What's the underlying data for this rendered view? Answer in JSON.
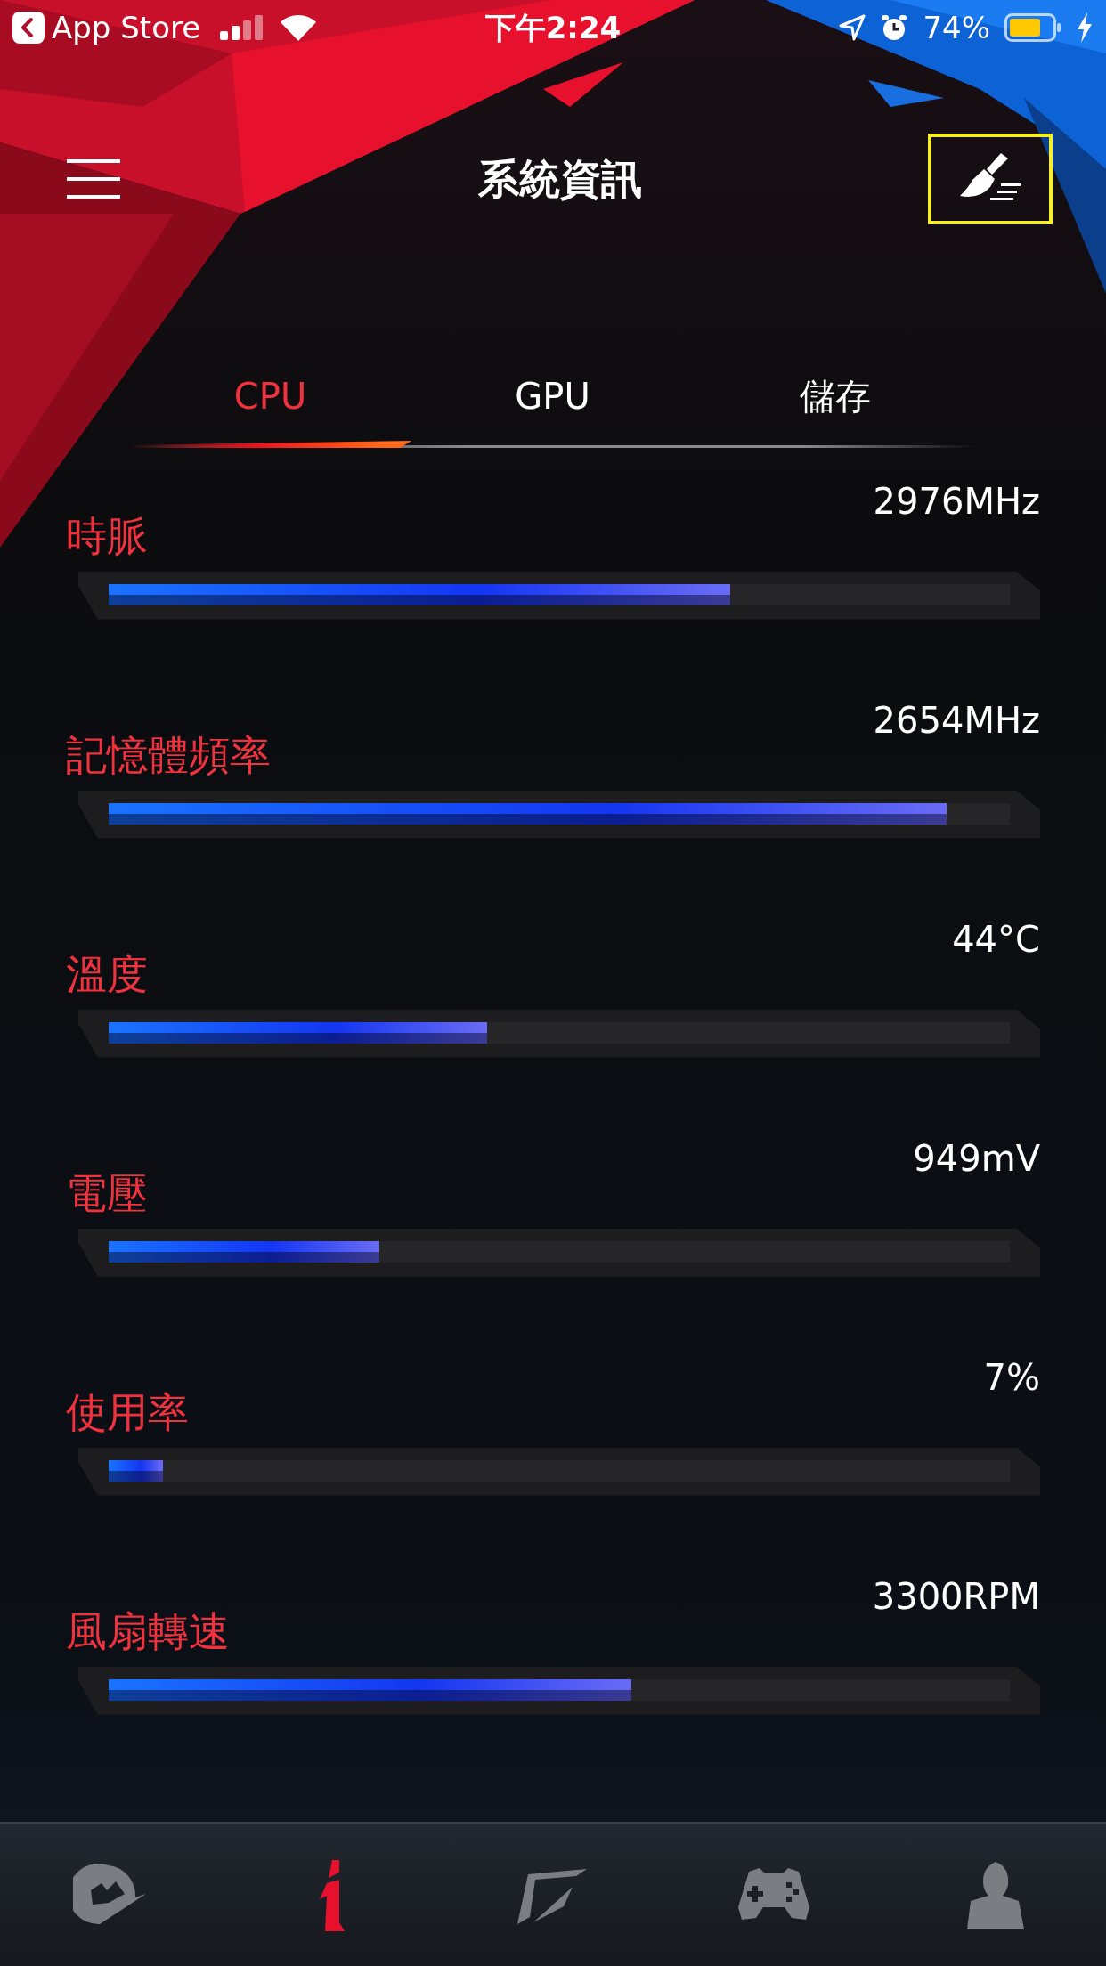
{
  "status_bar": {
    "back_label": "App Store",
    "time": "下午2:24",
    "battery": "74%"
  },
  "header": {
    "title": "系統資訊"
  },
  "tabs": [
    {
      "label": "CPU",
      "selected": true
    },
    {
      "label": "GPU",
      "selected": false
    },
    {
      "label": "儲存",
      "selected": false
    }
  ],
  "metrics": [
    {
      "label": "時脈",
      "value": "2976MHz",
      "level": 0.69
    },
    {
      "label": "記憶體頻率",
      "value": "2654MHz",
      "level": 0.93
    },
    {
      "label": "溫度",
      "value": "44°C",
      "level": 0.42
    },
    {
      "label": "電壓",
      "value": "949mV",
      "level": 0.3
    },
    {
      "label": "使用率",
      "value": "7%",
      "level": 0.06
    },
    {
      "label": "風扇轉速",
      "value": "3300RPM",
      "level": 0.58
    }
  ],
  "bottom_nav": [
    {
      "kind": "emblem",
      "selected": false
    },
    {
      "kind": "info",
      "selected": true
    },
    {
      "kind": "screen",
      "selected": false
    },
    {
      "kind": "gamepad",
      "selected": false
    },
    {
      "kind": "profile",
      "selected": false
    }
  ]
}
